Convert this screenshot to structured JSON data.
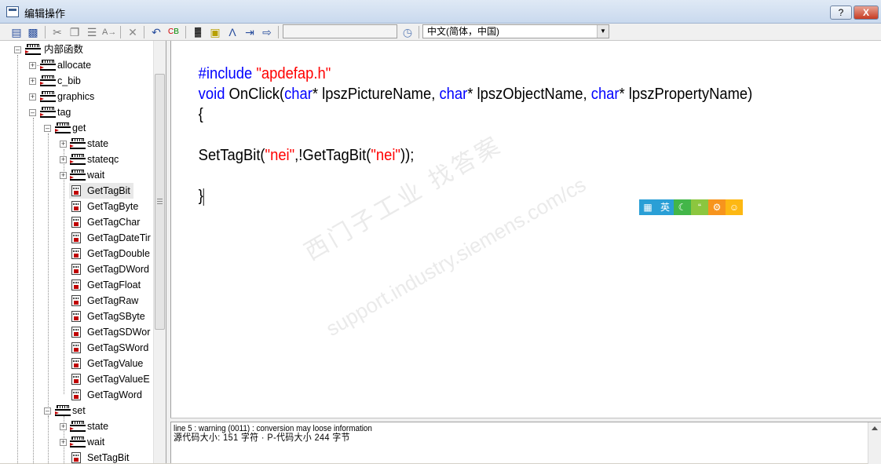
{
  "window": {
    "title": "编辑操作",
    "help_label": "?",
    "close_label": "X"
  },
  "toolbar": {
    "language": "中文(简体，中国)",
    "icons": [
      "save-icon",
      "save-as-icon",
      "cut-icon",
      "copy-icon",
      "paste-icon",
      "replace-icon",
      "delete-icon",
      "undo-icon",
      "compile-icon",
      "tags-icon",
      "cube-icon",
      "compass-icon",
      "import-icon",
      "export-icon",
      "clock-icon"
    ]
  },
  "tree": {
    "root": "内部函数",
    "items": [
      {
        "label": "allocate"
      },
      {
        "label": "c_bib"
      },
      {
        "label": "graphics"
      },
      {
        "label": "tag"
      },
      {
        "label": "get"
      },
      {
        "label": "state"
      },
      {
        "label": "stateqc"
      },
      {
        "label": "wait"
      },
      {
        "label": "GetTagBit"
      },
      {
        "label": "GetTagByte"
      },
      {
        "label": "GetTagChar"
      },
      {
        "label": "GetTagDateTir"
      },
      {
        "label": "GetTagDouble"
      },
      {
        "label": "GetTagDWord"
      },
      {
        "label": "GetTagFloat"
      },
      {
        "label": "GetTagRaw"
      },
      {
        "label": "GetTagSByte"
      },
      {
        "label": "GetTagSDWor"
      },
      {
        "label": "GetTagSWord"
      },
      {
        "label": "GetTagValue"
      },
      {
        "label": "GetTagValueE"
      },
      {
        "label": "GetTagWord"
      },
      {
        "label": "set"
      },
      {
        "label": "state"
      },
      {
        "label": "wait"
      },
      {
        "label": "SetTagBit"
      }
    ]
  },
  "editor": {
    "line1": {
      "kw": "#include ",
      "str": "\"apdefap.h\""
    },
    "line2": {
      "kw1": "void",
      "p1": " OnClick(",
      "kw2": "char",
      "p2": "* lpszPictureName, ",
      "kw3": "char",
      "p3": "* lpszObjectName, ",
      "kw4": "char",
      "p4": "* lpszPropertyName)"
    },
    "line3": "{",
    "line5": {
      "p1": "SetTagBit(",
      "s1": "\"nei\"",
      "p2": ",!GetTagBit(",
      "s2": "\"nei\"",
      "p3": "));"
    },
    "line7": "}"
  },
  "ime": {
    "english": "英",
    "colors": [
      "#2a9fd6",
      "#2a9fd6",
      "#43b649",
      "#8cc63f",
      "#f7941d",
      "#fdb813"
    ]
  },
  "watermark": {
    "line1": "西门子工业  找答案",
    "line2": "support.industry.siemens.com/cs"
  },
  "output": {
    "line1": "line 5 : warning (0011) : conversion may loose information",
    "line2": "源代码大小: 151 字符 · P-代码大小 244 字节"
  }
}
